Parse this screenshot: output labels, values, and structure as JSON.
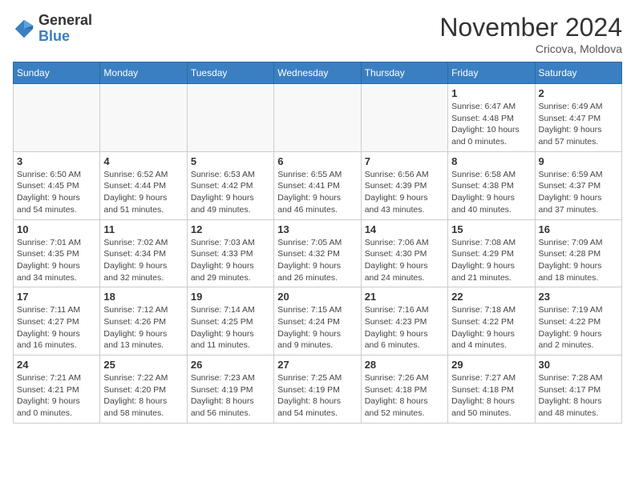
{
  "header": {
    "logo_general": "General",
    "logo_blue": "Blue",
    "month_title": "November 2024",
    "location": "Cricova, Moldova"
  },
  "weekdays": [
    "Sunday",
    "Monday",
    "Tuesday",
    "Wednesday",
    "Thursday",
    "Friday",
    "Saturday"
  ],
  "weeks": [
    [
      {
        "day": "",
        "info": ""
      },
      {
        "day": "",
        "info": ""
      },
      {
        "day": "",
        "info": ""
      },
      {
        "day": "",
        "info": ""
      },
      {
        "day": "",
        "info": ""
      },
      {
        "day": "1",
        "info": "Sunrise: 6:47 AM\nSunset: 4:48 PM\nDaylight: 10 hours\nand 0 minutes."
      },
      {
        "day": "2",
        "info": "Sunrise: 6:49 AM\nSunset: 4:47 PM\nDaylight: 9 hours\nand 57 minutes."
      }
    ],
    [
      {
        "day": "3",
        "info": "Sunrise: 6:50 AM\nSunset: 4:45 PM\nDaylight: 9 hours\nand 54 minutes."
      },
      {
        "day": "4",
        "info": "Sunrise: 6:52 AM\nSunset: 4:44 PM\nDaylight: 9 hours\nand 51 minutes."
      },
      {
        "day": "5",
        "info": "Sunrise: 6:53 AM\nSunset: 4:42 PM\nDaylight: 9 hours\nand 49 minutes."
      },
      {
        "day": "6",
        "info": "Sunrise: 6:55 AM\nSunset: 4:41 PM\nDaylight: 9 hours\nand 46 minutes."
      },
      {
        "day": "7",
        "info": "Sunrise: 6:56 AM\nSunset: 4:39 PM\nDaylight: 9 hours\nand 43 minutes."
      },
      {
        "day": "8",
        "info": "Sunrise: 6:58 AM\nSunset: 4:38 PM\nDaylight: 9 hours\nand 40 minutes."
      },
      {
        "day": "9",
        "info": "Sunrise: 6:59 AM\nSunset: 4:37 PM\nDaylight: 9 hours\nand 37 minutes."
      }
    ],
    [
      {
        "day": "10",
        "info": "Sunrise: 7:01 AM\nSunset: 4:35 PM\nDaylight: 9 hours\nand 34 minutes."
      },
      {
        "day": "11",
        "info": "Sunrise: 7:02 AM\nSunset: 4:34 PM\nDaylight: 9 hours\nand 32 minutes."
      },
      {
        "day": "12",
        "info": "Sunrise: 7:03 AM\nSunset: 4:33 PM\nDaylight: 9 hours\nand 29 minutes."
      },
      {
        "day": "13",
        "info": "Sunrise: 7:05 AM\nSunset: 4:32 PM\nDaylight: 9 hours\nand 26 minutes."
      },
      {
        "day": "14",
        "info": "Sunrise: 7:06 AM\nSunset: 4:30 PM\nDaylight: 9 hours\nand 24 minutes."
      },
      {
        "day": "15",
        "info": "Sunrise: 7:08 AM\nSunset: 4:29 PM\nDaylight: 9 hours\nand 21 minutes."
      },
      {
        "day": "16",
        "info": "Sunrise: 7:09 AM\nSunset: 4:28 PM\nDaylight: 9 hours\nand 18 minutes."
      }
    ],
    [
      {
        "day": "17",
        "info": "Sunrise: 7:11 AM\nSunset: 4:27 PM\nDaylight: 9 hours\nand 16 minutes."
      },
      {
        "day": "18",
        "info": "Sunrise: 7:12 AM\nSunset: 4:26 PM\nDaylight: 9 hours\nand 13 minutes."
      },
      {
        "day": "19",
        "info": "Sunrise: 7:14 AM\nSunset: 4:25 PM\nDaylight: 9 hours\nand 11 minutes."
      },
      {
        "day": "20",
        "info": "Sunrise: 7:15 AM\nSunset: 4:24 PM\nDaylight: 9 hours\nand 9 minutes."
      },
      {
        "day": "21",
        "info": "Sunrise: 7:16 AM\nSunset: 4:23 PM\nDaylight: 9 hours\nand 6 minutes."
      },
      {
        "day": "22",
        "info": "Sunrise: 7:18 AM\nSunset: 4:22 PM\nDaylight: 9 hours\nand 4 minutes."
      },
      {
        "day": "23",
        "info": "Sunrise: 7:19 AM\nSunset: 4:22 PM\nDaylight: 9 hours\nand 2 minutes."
      }
    ],
    [
      {
        "day": "24",
        "info": "Sunrise: 7:21 AM\nSunset: 4:21 PM\nDaylight: 9 hours\nand 0 minutes."
      },
      {
        "day": "25",
        "info": "Sunrise: 7:22 AM\nSunset: 4:20 PM\nDaylight: 8 hours\nand 58 minutes."
      },
      {
        "day": "26",
        "info": "Sunrise: 7:23 AM\nSunset: 4:19 PM\nDaylight: 8 hours\nand 56 minutes."
      },
      {
        "day": "27",
        "info": "Sunrise: 7:25 AM\nSunset: 4:19 PM\nDaylight: 8 hours\nand 54 minutes."
      },
      {
        "day": "28",
        "info": "Sunrise: 7:26 AM\nSunset: 4:18 PM\nDaylight: 8 hours\nand 52 minutes."
      },
      {
        "day": "29",
        "info": "Sunrise: 7:27 AM\nSunset: 4:18 PM\nDaylight: 8 hours\nand 50 minutes."
      },
      {
        "day": "30",
        "info": "Sunrise: 7:28 AM\nSunset: 4:17 PM\nDaylight: 8 hours\nand 48 minutes."
      }
    ]
  ]
}
